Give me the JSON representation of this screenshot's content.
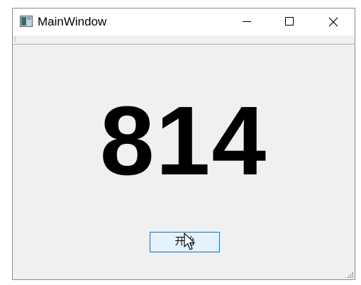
{
  "window": {
    "title": "MainWindow"
  },
  "caption_buttons": {
    "minimize": "minimize-icon",
    "maximize": "maximize-icon",
    "close": "close-icon"
  },
  "main": {
    "number": "814",
    "start_button_label": "开始"
  },
  "colors": {
    "window_bg": "#f0f0f0",
    "titlebar_bg": "#ffffff",
    "button_bg": "#e5f1fb",
    "button_border": "#0078d7"
  }
}
